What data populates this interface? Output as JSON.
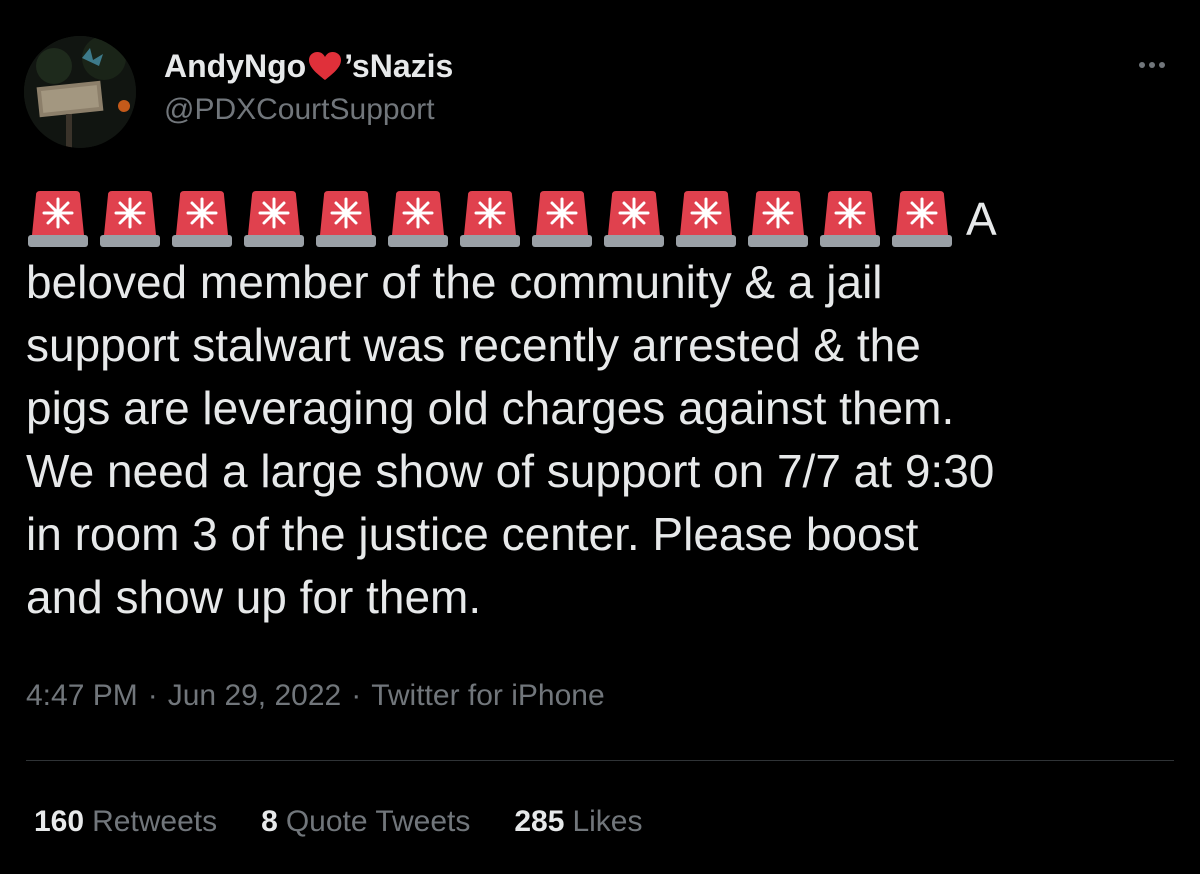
{
  "tweet": {
    "author": {
      "name_prefix": "AndyNgo",
      "name_suffix": "’sNazis",
      "name_emoji": "red-heart-emoji",
      "handle": "@PDXCourtSupport",
      "avatar": "user-avatar-photo"
    },
    "more_icon": "more-options-icon",
    "siren_emoji": "police-car-light-emoji",
    "siren_count": 13,
    "siren_tail": "A",
    "body_lines": [
      "beloved member of the community & a jail",
      "support stalwart was recently arrested & the",
      "pigs are leveraging old charges against them.",
      "We need a large show of support on 7/7 at 9:30",
      "in room 3 of the justice center.  Please boost",
      "and show up for them."
    ],
    "time": "4:47 PM",
    "separator": "·",
    "date": "Jun 29, 2022",
    "source": "Twitter for iPhone"
  },
  "stats": {
    "retweets_count": "160",
    "retweets_label": "Retweets",
    "quotes_count": "8",
    "quotes_label": "Quote Tweets",
    "likes_count": "285",
    "likes_label": "Likes"
  },
  "colors": {
    "background": "#000000",
    "primary_text": "#e7e9ea",
    "secondary_text": "#71767b",
    "divider": "#2f3336",
    "siren_red": "#e0414e",
    "heart_red": "#e0303a"
  }
}
